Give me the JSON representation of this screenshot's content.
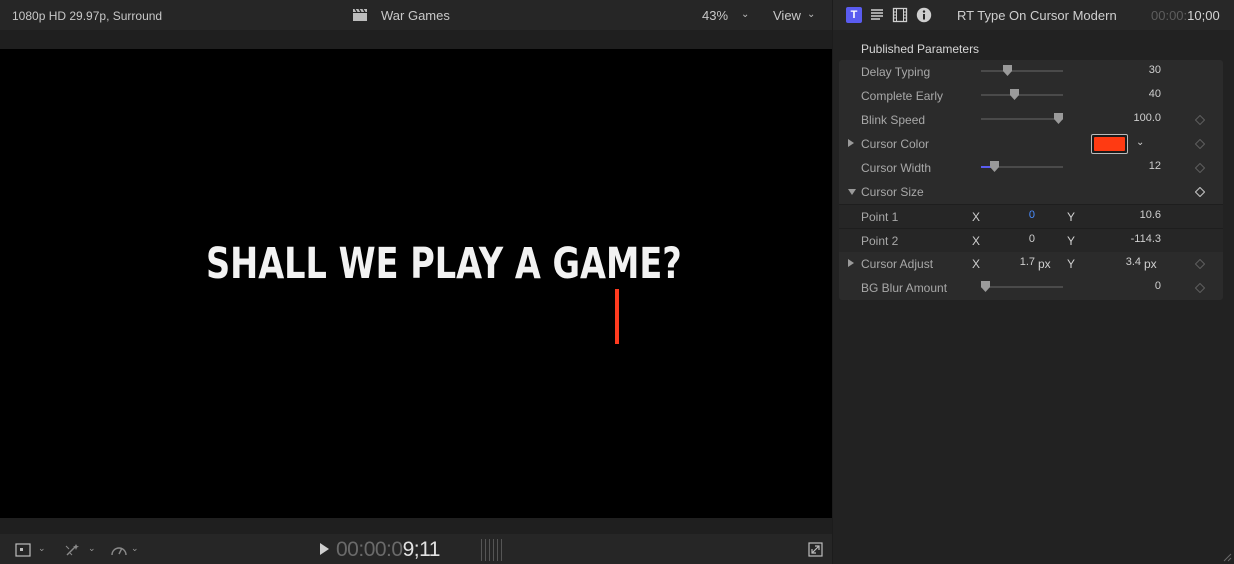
{
  "viewer": {
    "format": "1080p HD 29.97p, Surround",
    "project_title": "War Games",
    "zoom": "43%",
    "view_label": "View",
    "canvas_text": "SHALL WE PLAY A GAME?",
    "cursor_color": "#ff3b1f",
    "timecode_dim": "00:00:0",
    "timecode_bright": "9;11"
  },
  "inspector": {
    "title": "RT Type On Cursor Modern",
    "duration_dim": "00:00:",
    "duration_bright": "10;00",
    "tab_title_glyph": "T",
    "tab_icons": [
      "title-tab-icon",
      "text-tab-icon",
      "video-tab-icon",
      "info-tab-icon"
    ],
    "section_title": "Published Parameters",
    "params": {
      "delay_typing": {
        "label": "Delay Typing",
        "value": "30",
        "slider": 0.3
      },
      "complete_early": {
        "label": "Complete Early",
        "value": "40",
        "slider": 0.4
      },
      "blink_speed": {
        "label": "Blink Speed",
        "value": "100.0",
        "slider": 1.0
      },
      "cursor_color": {
        "label": "Cursor Color",
        "color": "#ff3a12"
      },
      "cursor_width": {
        "label": "Cursor Width",
        "value": "12",
        "slider": 0.12
      },
      "cursor_size": {
        "label": "Cursor Size"
      },
      "point1": {
        "label": "Point 1",
        "x_axis": "X",
        "x": "0",
        "y_axis": "Y",
        "y": "10.6"
      },
      "point2": {
        "label": "Point 2",
        "x_axis": "X",
        "x": "0",
        "y_axis": "Y",
        "y": "-114.3"
      },
      "cursor_adjust": {
        "label": "Cursor Adjust",
        "x_axis": "X",
        "x": "1.7",
        "x_unit": "px",
        "y_axis": "Y",
        "y": "3.4",
        "y_unit": "px"
      },
      "bg_blur": {
        "label": "BG Blur Amount",
        "value": "0",
        "slider": 0.0
      }
    }
  }
}
